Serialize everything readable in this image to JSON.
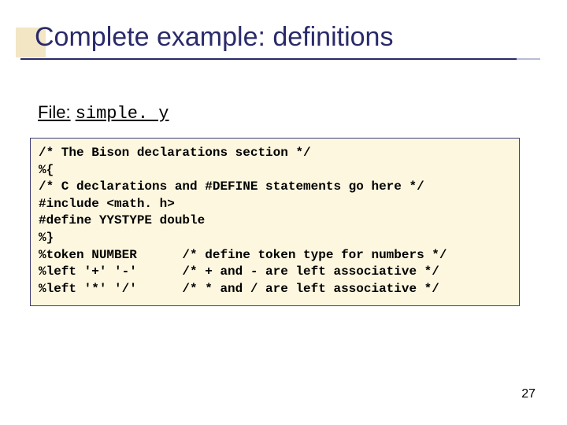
{
  "title": "Complete example: definitions",
  "file": {
    "label": "File:",
    "name": "simple. y"
  },
  "code": "/* The Bison declarations section */\n%{\n/* C declarations and #DEFINE statements go here */\n#include <math. h>\n#define YYSTYPE double\n%}\n%token NUMBER      /* define token type for numbers */\n%left '+' '-'      /* + and - are left associative */\n%left '*' '/'      /* * and / are left associative */",
  "page_number": "27"
}
